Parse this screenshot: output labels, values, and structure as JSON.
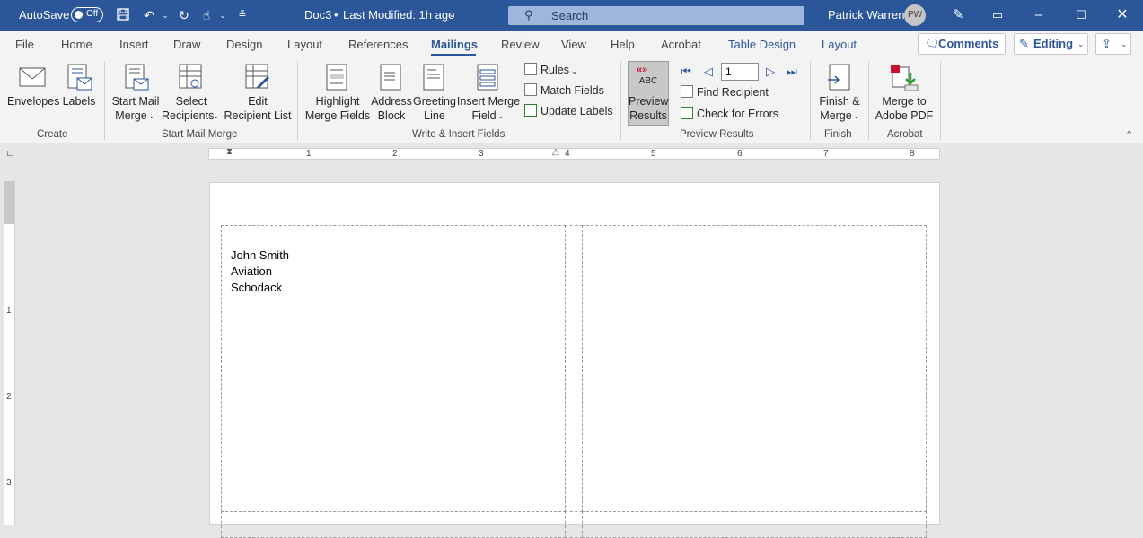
{
  "titlebar": {
    "autosave_label": "AutoSave",
    "autosave_state": "Off",
    "doc_title": "Doc3",
    "separator": "•",
    "last_modified": "Last Modified: 1h ago",
    "search_placeholder": "Search",
    "user_name": "Patrick Warren",
    "user_initials": "PW"
  },
  "tabs": [
    {
      "label": "File"
    },
    {
      "label": "Home"
    },
    {
      "label": "Insert"
    },
    {
      "label": "Draw"
    },
    {
      "label": "Design"
    },
    {
      "label": "Layout"
    },
    {
      "label": "References"
    },
    {
      "label": "Mailings"
    },
    {
      "label": "Review"
    },
    {
      "label": "View"
    },
    {
      "label": "Help"
    },
    {
      "label": "Acrobat"
    },
    {
      "label": "Table Design"
    },
    {
      "label": "Layout"
    }
  ],
  "tab_actions": {
    "comments": "Comments",
    "editing": "Editing"
  },
  "ribbon": {
    "create": {
      "group_label": "Create",
      "envelopes": "Envelopes",
      "labels": "Labels"
    },
    "start_mail_merge": {
      "group_label": "Start Mail Merge",
      "start_line1": "Start Mail",
      "start_line2": "Merge",
      "select_line1": "Select",
      "select_line2": "Recipients",
      "edit_line1": "Edit",
      "edit_line2": "Recipient List"
    },
    "write_insert": {
      "group_label": "Write & Insert Fields",
      "highlight_line1": "Highlight",
      "highlight_line2": "Merge Fields",
      "address_line1": "Address",
      "address_line2": "Block",
      "greeting_line1": "Greeting",
      "greeting_line2": "Line",
      "insert_line1": "Insert Merge",
      "insert_line2": "Field",
      "rules": "Rules",
      "match_fields": "Match Fields",
      "update_labels": "Update Labels"
    },
    "preview": {
      "group_label": "Preview Results",
      "abc": "ABC",
      "preview_line1": "Preview",
      "preview_line2": "Results",
      "record_number": "1",
      "find_recipient": "Find Recipient",
      "check_errors": "Check for Errors"
    },
    "finish": {
      "group_label": "Finish",
      "line1": "Finish &",
      "line2": "Merge"
    },
    "acrobat": {
      "group_label": "Acrobat",
      "line1": "Merge to",
      "line2": "Adobe PDF"
    }
  },
  "ruler": {
    "h_numbers": [
      "1",
      "2",
      "3",
      "4",
      "5",
      "6",
      "7",
      "8"
    ],
    "v_numbers": [
      "1",
      "2",
      "3"
    ]
  },
  "document": {
    "label1": {
      "line1": "John Smith",
      "line2": "Aviation",
      "line3": "Schodack"
    }
  }
}
